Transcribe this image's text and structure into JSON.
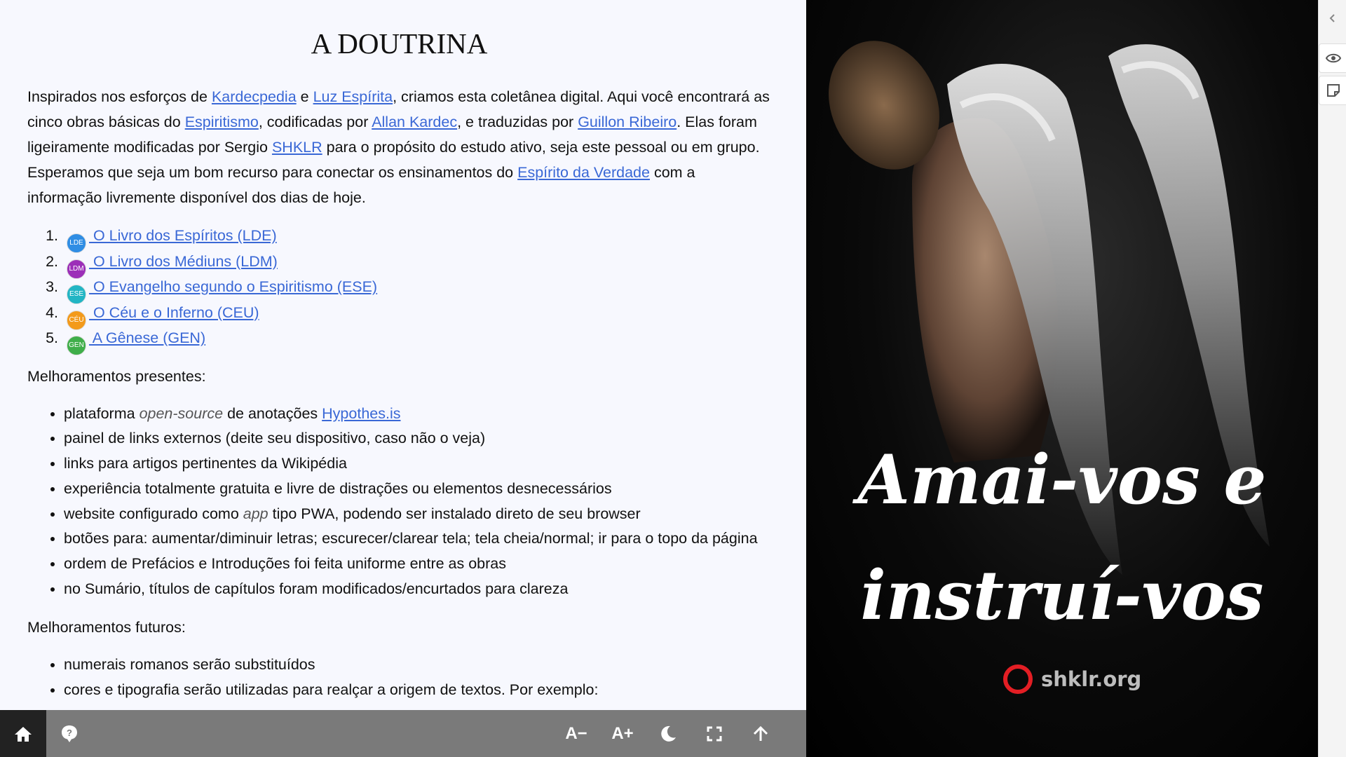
{
  "doc": {
    "title": "A DOUTRINA",
    "intro": {
      "t1": "Inspirados nos esforços de ",
      "l1": "Kardecpedia",
      "t2": " e ",
      "l2": "Luz Espírita",
      "t3": ", criamos esta coletânea digital. Aqui você encontrará as cinco obras básicas do ",
      "l3": "Espiritismo",
      "t4": ", codificadas por ",
      "l4": "Allan Kardec",
      "t5": ", e traduzidas por ",
      "l5": "Guillon Ribeiro",
      "t6": ". Elas foram ligeiramente modificadas por Sergio ",
      "l6": "SHKLR",
      "t7": " para o propósito do estudo ativo, seja este pessoal ou em grupo. Esperamos que seja um bom recurso para conectar os ensinamentos do ",
      "l7": "Espírito da Verdade",
      "t8": " com a informação livremente disponível dos dias de hoje."
    },
    "books": [
      {
        "badge": "LDE",
        "color": "#2f8de4",
        "label": " O Livro dos Espíritos (LDE)"
      },
      {
        "badge": "LDM",
        "color": "#9c2fb8",
        "label": " O Livro dos Médiuns (LDM)"
      },
      {
        "badge": "ESE",
        "color": "#22b5c4",
        "label": " O Evangelho segundo o Espiritismo (ESE)"
      },
      {
        "badge": "CÉU",
        "color": "#f39a1b",
        "label": " O Céu e o Inferno (CEU)"
      },
      {
        "badge": "GEN",
        "color": "#3fae4a",
        "label": " A Gênese (GEN)"
      }
    ],
    "present_heading": "Melhoramentos presentes:",
    "present": {
      "i1a": "plataforma ",
      "i1em": "open-source",
      "i1b": " de anotações ",
      "i1link": "Hypothes.is",
      "i2": "painel de links externos (deite seu dispositivo, caso não o veja)",
      "i3": "links para artigos pertinentes da Wikipédia",
      "i4": "experiência totalmente gratuita e livre de distrações ou elementos desnecessários",
      "i5a": "website configurado como ",
      "i5em": "app",
      "i5b": " tipo PWA, podendo ser instalado direto de seu browser",
      "i6": "botões para: aumentar/diminuir letras; escurecer/clarear tela; tela cheia/normal; ir para o topo da página",
      "i7": "ordem de Prefácios e Introduções foi feita uniforme entre as obras",
      "i8": "no Sumário, títulos de capítulos foram modificados/encurtados para clareza"
    },
    "future_heading": "Melhoramentos futuros:",
    "future": {
      "i1": "numerais romanos serão substituídos",
      "i2": "cores e tipografia serão utilizadas para realçar a origem de textos. Por exemplo:"
    }
  },
  "toolbar": {
    "home_icon": "home-icon",
    "help_icon": "help-icon",
    "font_decrease": "A−",
    "font_increase": "A+",
    "dark_icon": "moon-icon",
    "fullscreen_icon": "fullscreen-icon",
    "top_icon": "arrow-up-icon"
  },
  "cover": {
    "line1": "Amai-vos e",
    "line2": "instruí-vos",
    "brand": "shklr.org"
  },
  "sidebar": {
    "collapse_icon": "chevron-left-icon",
    "visibility_icon": "eye-icon",
    "annotation_icon": "note-icon"
  },
  "colors": {
    "link": "#3a68d6",
    "background": "#f7f8fe",
    "toolbar": "#7a7a7a",
    "brand_red": "#e31e24"
  }
}
